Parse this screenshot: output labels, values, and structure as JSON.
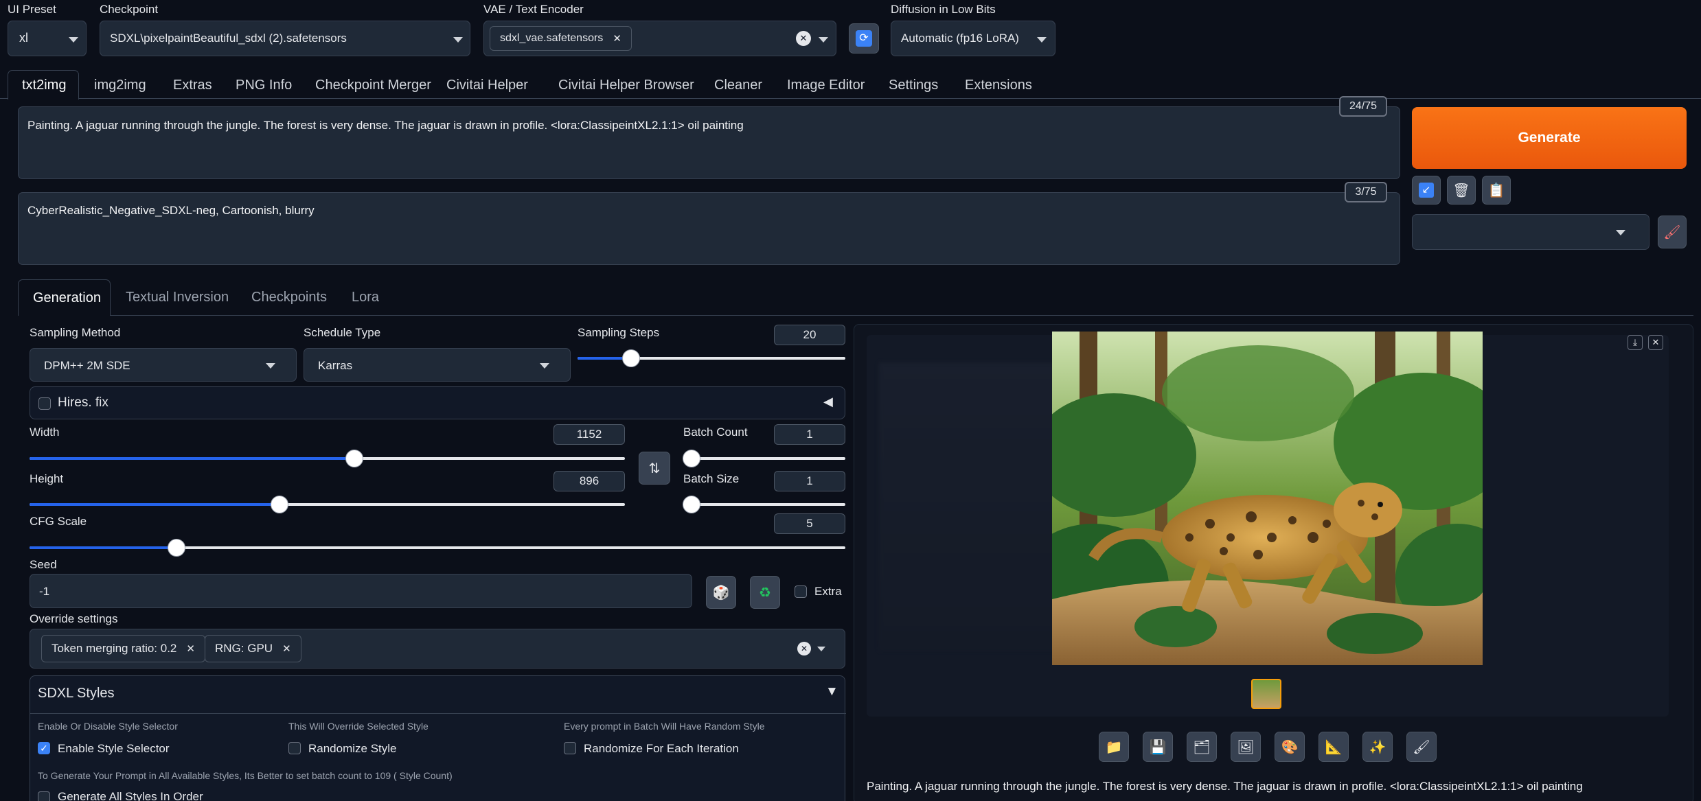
{
  "top": {
    "ui_preset": {
      "label": "UI Preset",
      "value": "xl"
    },
    "checkpoint": {
      "label": "Checkpoint",
      "value": "SDXL\\pixelpaintBeautiful_sdxl (2).safetensors"
    },
    "vae": {
      "label": "VAE / Text Encoder",
      "token": "sdxl_vae.safetensors"
    },
    "diffusion": {
      "label": "Diffusion in Low Bits",
      "value": "Automatic (fp16 LoRA)"
    }
  },
  "tabs": [
    "txt2img",
    "img2img",
    "Extras",
    "PNG Info",
    "Checkpoint Merger",
    "Civitai Helper",
    "Civitai Helper Browser",
    "Cleaner",
    "Image Editor",
    "Settings",
    "Extensions"
  ],
  "prompt": {
    "text": "Painting. A jaguar running through the jungle. The forest is very dense. The jaguar is drawn in profile. <lora:ClassipeintXL2.1:1> oil painting",
    "count": "24/75"
  },
  "negative": {
    "text": "CyberRealistic_Negative_SDXL-neg, Cartoonish, blurry",
    "count": "3/75"
  },
  "generate_label": "Generate",
  "subtabs": [
    "Generation",
    "Textual Inversion",
    "Checkpoints",
    "Lora"
  ],
  "sampling": {
    "method_label": "Sampling Method",
    "method_value": "DPM++ 2M SDE",
    "schedule_label": "Schedule Type",
    "schedule_value": "Karras",
    "steps_label": "Sampling Steps",
    "steps_value": "20",
    "steps_level": 0.2
  },
  "hires_label": "Hires. fix",
  "width": {
    "label": "Width",
    "value": "1152",
    "level": 0.545
  },
  "height": {
    "label": "Height",
    "value": "896",
    "level": 0.42
  },
  "batch_count": {
    "label": "Batch Count",
    "value": "1",
    "level": 0.0
  },
  "batch_size": {
    "label": "Batch Size",
    "value": "1",
    "level": 0.0
  },
  "cfg": {
    "label": "CFG Scale",
    "value": "5",
    "level": 0.18
  },
  "seed": {
    "label": "Seed",
    "value": "-1",
    "extra_label": "Extra"
  },
  "override": {
    "label": "Override settings",
    "tokens": [
      "Token merging ratio: 0.2",
      "RNG: GPU"
    ]
  },
  "sdxl": {
    "title": "SDXL Styles",
    "hint1": "Enable Or Disable Style Selector",
    "hint2": "This Will Override Selected Style",
    "hint3": "Every prompt in Batch Will Have Random Style",
    "opt1": "Enable Style Selector",
    "opt2": "Randomize Style",
    "opt3": "Randomize For Each Iteration",
    "note": "To Generate Your Prompt in All Available Styles, Its Better to set batch count to 109 ( Style Count)",
    "opt4": "Generate All Styles In Order"
  },
  "output_caption": "Painting. A jaguar running through the jungle. The forest is very dense. The jaguar is drawn in profile. <lora:ClassipeintXL2.1:1> oil painting",
  "colors": {
    "accent": "#ea580c",
    "slider": "#2563eb",
    "bg": "#0b0f19"
  }
}
